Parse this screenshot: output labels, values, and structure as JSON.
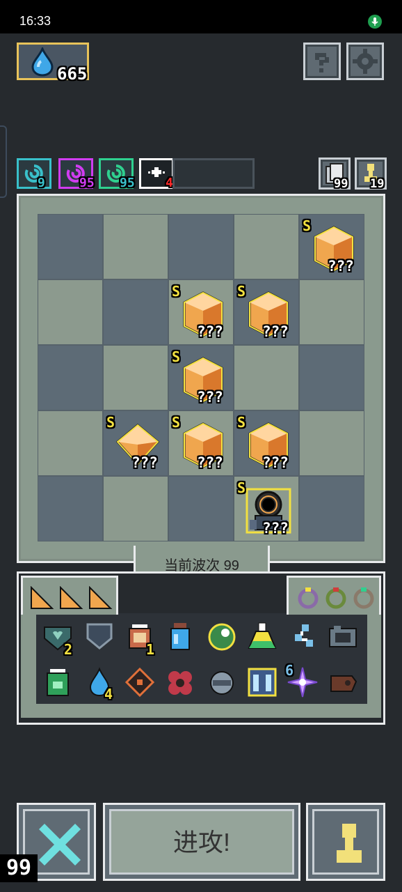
{
  "status_bar": {
    "time": "16:33"
  },
  "currency": {
    "value": "665",
    "icon": "water-drop-icon"
  },
  "top_buttons": [
    {
      "name": "help",
      "icon": "question-icon"
    },
    {
      "name": "settings",
      "icon": "gear-icon"
    }
  ],
  "buffs": [
    {
      "icon": "spiral-icon",
      "count": "9",
      "color": "#39c0ca"
    },
    {
      "icon": "spiral-icon",
      "count": "95",
      "color": "#d03cf0"
    },
    {
      "icon": "spiral-icon",
      "count": "95",
      "color": "#2fd08f"
    },
    {
      "icon": "sparkle-icon",
      "count": "4",
      "color": "#ffffff"
    }
  ],
  "right_counters": {
    "deck": "99",
    "units": "19"
  },
  "board": {
    "units": [
      {
        "rank": "S",
        "label": "???",
        "type": "crystal"
      },
      {
        "rank": "S",
        "label": "???",
        "type": "crystal"
      },
      {
        "rank": "S",
        "label": "???",
        "type": "crystal"
      },
      {
        "rank": "S",
        "label": "???",
        "type": "crystal"
      },
      {
        "rank": "S",
        "label": "???",
        "type": "diamond"
      },
      {
        "rank": "S",
        "label": "???",
        "type": "crystal"
      },
      {
        "rank": "S",
        "label": "???",
        "type": "crystal"
      },
      {
        "rank": "S",
        "label": "???",
        "type": "cannon"
      }
    ]
  },
  "wave": {
    "label": "当前波次 99"
  },
  "inventory": {
    "counts": {
      "heart_shield": "2",
      "lantern": "1",
      "water": "4",
      "star": "6"
    }
  },
  "bottom": {
    "attack_label": "进攻!",
    "corner_number": "99"
  },
  "colors": {
    "accent_gold": "#e8c35a",
    "rank_yellow": "#f2e040",
    "frame": "#e8eaec"
  }
}
